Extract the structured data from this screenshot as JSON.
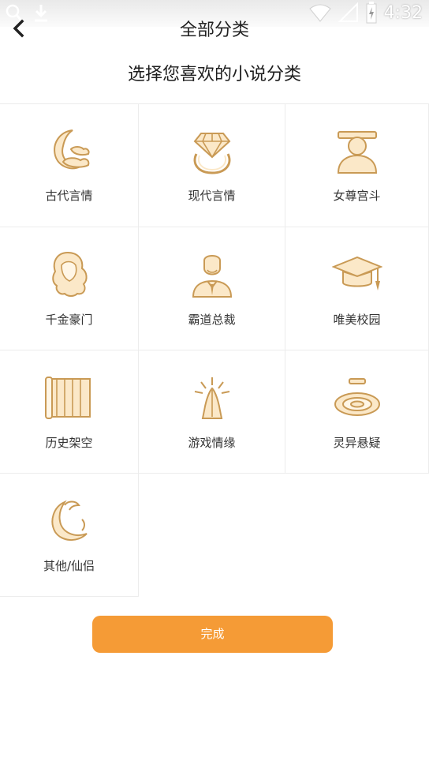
{
  "status_bar": {
    "time": "4:32",
    "icons": [
      "search-icon",
      "download-icon",
      "wifi-icon",
      "no-signal-icon",
      "battery-charging-icon"
    ]
  },
  "header": {
    "title": "全部分类",
    "back_icon": "chevron-left-icon"
  },
  "subtitle": "选择您喜欢的小说分类",
  "categories": [
    {
      "label": "古代言情",
      "icon": "crescent-cloud-icon"
    },
    {
      "label": "现代言情",
      "icon": "diamond-ring-icon"
    },
    {
      "label": "女尊宫斗",
      "icon": "crowned-figure-icon"
    },
    {
      "label": "千金豪门",
      "icon": "lady-hair-icon"
    },
    {
      "label": "霸道总裁",
      "icon": "businessman-icon"
    },
    {
      "label": "唯美校园",
      "icon": "graduation-cap-icon"
    },
    {
      "label": "历史架空",
      "icon": "bamboo-scroll-icon"
    },
    {
      "label": "游戏情缘",
      "icon": "praying-hands-icon"
    },
    {
      "label": "灵异悬疑",
      "icon": "ring-target-icon"
    },
    {
      "label": "其他/仙侣",
      "icon": "phoenix-moon-icon"
    }
  ],
  "colors": {
    "accent": "#f59b36",
    "icon_fill": "#fbe8c8",
    "icon_stroke": "#c99a55"
  },
  "done_button": {
    "label": "完成"
  }
}
